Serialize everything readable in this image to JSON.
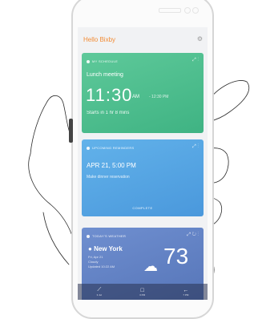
{
  "app": {
    "title": "Hello Bixby"
  },
  "cards": {
    "schedule": {
      "header": "MY SCHEDULE",
      "event_title": "Lunch meeting",
      "time": "11:30",
      "ampm": "AM",
      "end_time": "- 12:30 PM",
      "note": "Starts in 1 hr 8 mins",
      "color": "#4cbc8c"
    },
    "reminder": {
      "header": "UPCOMING REMINDERS",
      "date": "APR 21, 5:00 PM",
      "note": "Make dinner reservation",
      "action": "COMPLETE",
      "color": "#56a4e3"
    },
    "weather": {
      "header": "TODAY'S WEATHER",
      "city": "New York",
      "date": "Fri, Apr 21",
      "condition": "Cloudy",
      "updated": "Updated 10:22 AM",
      "temp": "73",
      "color": "#6483c4"
    }
  },
  "navbar": {
    "items": [
      {
        "icon": "trend-icon",
        "label": "3 Jul"
      },
      {
        "icon": "square-icon",
        "label": "3 PM"
      },
      {
        "icon": "back-icon",
        "label": "7 PM"
      }
    ]
  }
}
